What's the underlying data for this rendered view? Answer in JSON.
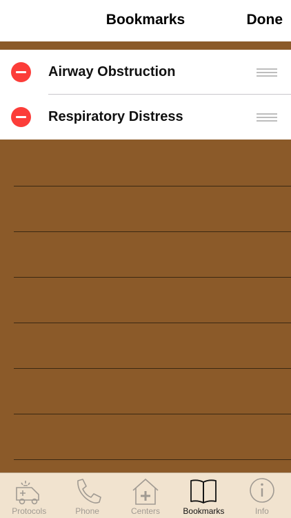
{
  "navbar": {
    "title": "Bookmarks",
    "done_label": "Done"
  },
  "bookmarks": [
    {
      "label": "Airway Obstruction"
    },
    {
      "label": "Respiratory Distress"
    }
  ],
  "tabbar": {
    "tabs": [
      {
        "label": "Protocols",
        "icon": "ambulance-icon",
        "active": false
      },
      {
        "label": "Phone",
        "icon": "phone-icon",
        "active": false
      },
      {
        "label": "Centers",
        "icon": "medical-center-icon",
        "active": false
      },
      {
        "label": "Bookmarks",
        "icon": "book-icon",
        "active": true
      },
      {
        "label": "Info",
        "icon": "info-icon",
        "active": false
      }
    ]
  },
  "colors": {
    "wood": "#8b5a29",
    "tabbar_bg": "#f1e3cf",
    "delete_red": "#fc3d39"
  }
}
